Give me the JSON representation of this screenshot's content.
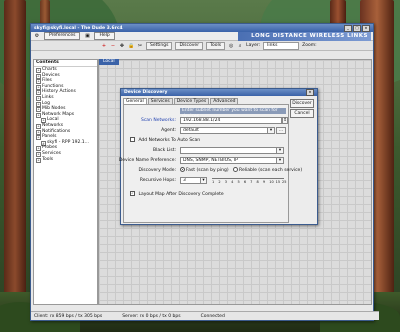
{
  "main_window": {
    "title": "skyfi@skyfi.local - The Dude 3.6rc4",
    "menu": [
      "Preferences",
      "Help"
    ],
    "banner": "LONG DISTANCE WIRELESS LINKS",
    "toolbar": {
      "settings": "Settings",
      "discover": "Discover",
      "tools": "Tools",
      "layer_label": "Layer:",
      "layer_value": "links",
      "zoom_label": "Zoom:"
    },
    "inner_tab": "Local",
    "sidebar_title": "Contents",
    "tree": [
      {
        "label": "Charts",
        "sub": false
      },
      {
        "label": "Devices",
        "sub": false
      },
      {
        "label": "Files",
        "sub": false
      },
      {
        "label": "Functions",
        "sub": false
      },
      {
        "label": "History Actions",
        "sub": false
      },
      {
        "label": "Links",
        "sub": false
      },
      {
        "label": "Log",
        "sub": false
      },
      {
        "label": "Mib Nodes",
        "sub": false
      },
      {
        "label": "Network Maps",
        "sub": false
      },
      {
        "label": "Local",
        "sub": true
      },
      {
        "label": "Networks",
        "sub": false
      },
      {
        "label": "Notifications",
        "sub": false
      },
      {
        "label": "Panels",
        "sub": false
      },
      {
        "label": "skyfi - RPP 192.1...",
        "sub": true
      },
      {
        "label": "Probes",
        "sub": false
      },
      {
        "label": "Services",
        "sub": false
      },
      {
        "label": "Tools",
        "sub": false
      }
    ],
    "status": {
      "client": "Client: rx 859 bps / tx 305 bps",
      "server": "Server: rx 0 bps / tx 0 bps",
      "state": "Connected"
    }
  },
  "dialog": {
    "title": "Device Discovery",
    "tabs": [
      "General",
      "Services",
      "Device Types",
      "Advanced"
    ],
    "active_tab": "General",
    "buttons": {
      "discover": "Discover",
      "cancel": "Cancel"
    },
    "hint": "Enter subnet number you want to scan for devices",
    "scan_networks_label": "Scan Networks:",
    "scan_networks_value": "192.168.88.1/24",
    "agent_label": "Agent:",
    "agent_value": "default",
    "agent_btn": "...",
    "auto_scan_label": "Add Networks To Auto Scan",
    "auto_scan_checked": false,
    "black_list_label": "Black List:",
    "black_list_value": "",
    "name_pref_label": "Device Name Preference:",
    "name_pref_value": "DNS, SNMP, NETBIOS, IP",
    "discovery_mode_label": "Discovery Mode:",
    "mode_fast": "Fast (scan by ping)",
    "mode_reliable": "Reliable (scan each service)",
    "mode_selected": "fast",
    "recursive_label": "Recursive Hops:",
    "recursive_value": "3",
    "slider_ticks": [
      "1",
      "2",
      "3",
      "4",
      "5",
      "6",
      "7",
      "8",
      "9",
      "10",
      "15",
      "25"
    ],
    "layout_label": "Layout Map After Discovery Complete",
    "layout_checked": true
  }
}
